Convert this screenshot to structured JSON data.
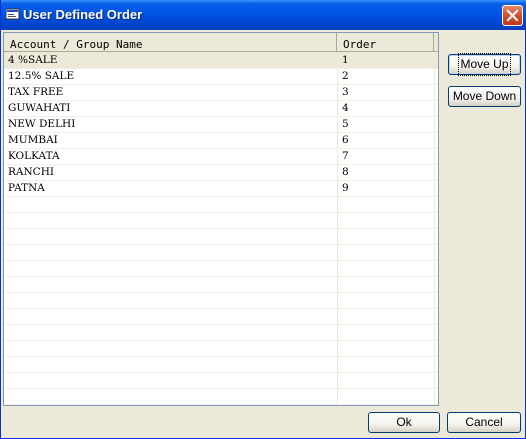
{
  "window": {
    "title": "User Defined Order"
  },
  "grid": {
    "columns": [
      "Account / Group Name",
      "Order"
    ],
    "rows": [
      {
        "name": "4 %SALE",
        "order": "1"
      },
      {
        "name": "12.5% SALE",
        "order": "2"
      },
      {
        "name": "TAX FREE",
        "order": "3"
      },
      {
        "name": "GUWAHATI",
        "order": "4"
      },
      {
        "name": "NEW DELHI",
        "order": "5"
      },
      {
        "name": "MUMBAI",
        "order": "6"
      },
      {
        "name": "KOLKATA",
        "order": "7"
      },
      {
        "name": "RANCHI",
        "order": "8"
      },
      {
        "name": "PATNA",
        "order": "9"
      }
    ],
    "selected_row": 0
  },
  "buttons": {
    "move_up": "Move Up",
    "move_down": "Move Down",
    "ok": "Ok",
    "cancel": "Cancel"
  }
}
